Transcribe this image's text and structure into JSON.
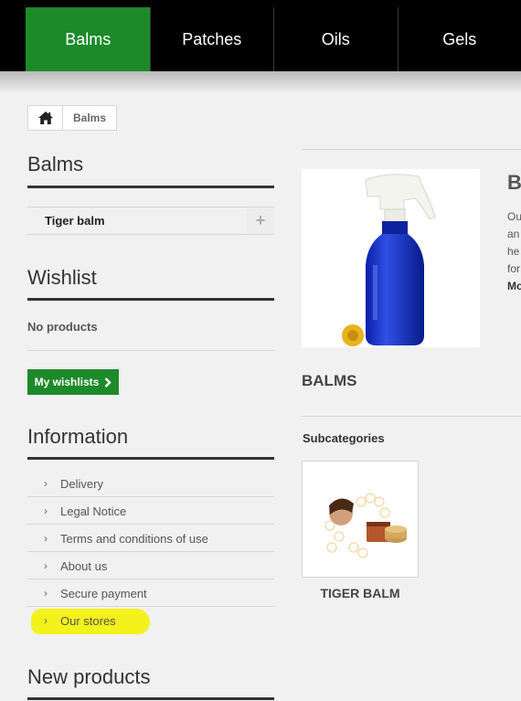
{
  "nav": {
    "items": [
      {
        "label": "Balms"
      },
      {
        "label": "Patches"
      },
      {
        "label": "Oils"
      },
      {
        "label": "Gels"
      }
    ],
    "active_color": "#1d8a2a"
  },
  "breadcrumb": {
    "home_icon": "home-icon",
    "current": "Balms"
  },
  "sidebar": {
    "categories_title": "Balms",
    "categories": [
      {
        "label": "Tiger balm",
        "expand_icon": "plus-icon"
      }
    ],
    "wishlist_title": "Wishlist",
    "wishlist_empty": "No products",
    "wishlist_button": "My wishlists",
    "information_title": "Information",
    "information_items": [
      {
        "label": "Delivery"
      },
      {
        "label": "Legal Notice"
      },
      {
        "label": "Terms and conditions of use"
      },
      {
        "label": "About us"
      },
      {
        "label": "Secure payment"
      },
      {
        "label": "Our stores"
      }
    ],
    "new_products_title": "New products",
    "highlight_color": "#f3f21c"
  },
  "main": {
    "category_title_partial": "B",
    "description_partial": [
      "Ou",
      "an",
      "he",
      "for"
    ],
    "more_partial": "Mo",
    "category_heading": "BALMS",
    "subcategories_title": "Subcategories",
    "subcategories": [
      {
        "label": "TIGER BALM"
      }
    ]
  }
}
